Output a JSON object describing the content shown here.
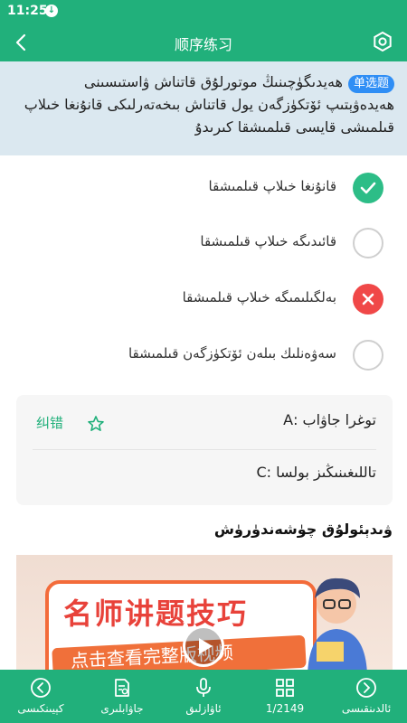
{
  "status": {
    "time": "11:25"
  },
  "appbar": {
    "title": "顺序练习"
  },
  "question": {
    "badge": "单选题",
    "text": "ھەيدىگۈچىنىڭ موتورلۇق قاتناش ۋاستىسىنى ھەيدەۋېتىپ ئۆتكۈزگەن يول قاتناش بىخەتەرلىكى قانۇنغا خىلاپ قىلمىشى قايسى قىلمىشقا كىرىدۇ"
  },
  "options": [
    {
      "text": "قانۇنغا خىلاپ قىلمىشقا",
      "state": "correct"
    },
    {
      "text": "قائىدىگە خىلاپ قىلمىشقا",
      "state": "empty"
    },
    {
      "text": "بەلگىلىمىگە خىلاپ قىلمىشقا",
      "state": "wrong"
    },
    {
      "text": "سەۋەنلىك بىلەن ئۆتكۈزگەن قىلمىشقا",
      "state": "empty"
    }
  ],
  "answer": {
    "correct_label": "توغرا جاۋاب :A",
    "your_label": "تاللىغىنىڭىز بولسا :C",
    "report": "纠错"
  },
  "analysis": {
    "title": "ۋىدېئولۇق چۈشەندۈرۈش"
  },
  "video": {
    "headline": "名师讲题技巧",
    "banner": "点击查看完整版视频"
  },
  "bottom_nav": [
    {
      "label": "كېيىنكىسى",
      "icon": "chevron-left-circle-icon"
    },
    {
      "label": "جاۋابلىرى",
      "icon": "answer-doc-icon"
    },
    {
      "label": "ئاۋازلىق",
      "icon": "microphone-icon"
    },
    {
      "label": "1/2149",
      "icon": "grid-icon"
    },
    {
      "label": "ئالدىنقىسى",
      "icon": "chevron-right-circle-icon"
    }
  ],
  "colors": {
    "brand": "#21b07b",
    "correct": "#2dbd87",
    "wrong": "#f04848",
    "question_bg": "#dbe8f0"
  }
}
